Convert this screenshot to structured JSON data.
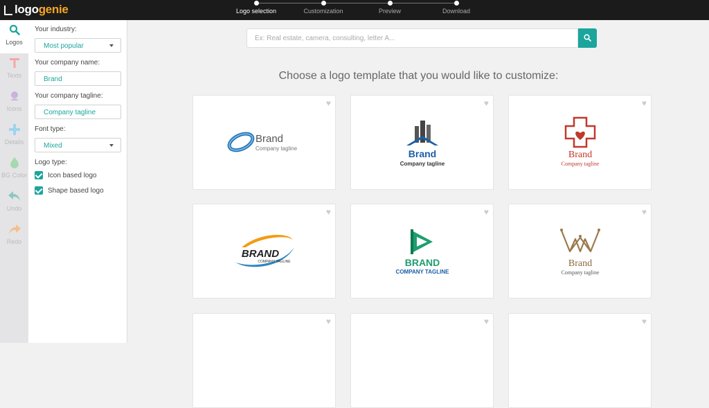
{
  "brand": {
    "part1": "logo",
    "part2": "genie"
  },
  "steps": [
    {
      "label": "Logo selection",
      "active": true
    },
    {
      "label": "Customization",
      "active": false
    },
    {
      "label": "Preview",
      "active": false
    },
    {
      "label": "Download",
      "active": false
    }
  ],
  "toolbar": [
    {
      "label": "Logos",
      "icon": "search-icon",
      "color": "#1ba59c"
    },
    {
      "label": "Texts",
      "icon": "text-icon",
      "color": "#f4a7a7"
    },
    {
      "label": "Icons",
      "icon": "icons-icon",
      "color": "#c9b3dd"
    },
    {
      "label": "Details",
      "icon": "plus-icon",
      "color": "#9fd3ef"
    },
    {
      "label": "BG Color",
      "icon": "drop-icon",
      "color": "#a7d9b0"
    },
    {
      "label": "Undo",
      "icon": "undo-icon",
      "color": "#8ec7c2"
    },
    {
      "label": "Redo",
      "icon": "redo-icon",
      "color": "#f5c08a"
    }
  ],
  "panel": {
    "industry_label": "Your industry:",
    "industry_value": "Most popular",
    "company_label": "Your company name:",
    "company_value": "Brand",
    "tagline_label": "Your company tagline:",
    "tagline_value": "Company tagline",
    "font_label": "Font type:",
    "font_value": "Mixed",
    "logotype_label": "Logo type:",
    "opt_icon": "Icon based logo",
    "opt_shape": "Shape based logo"
  },
  "search": {
    "placeholder": "Ex: Real estate, camera, consulting, letter A..."
  },
  "headline": "Choose a logo template that you would like to customize:",
  "cards": [
    {
      "name": "Brand",
      "tagline": "Company tagline"
    },
    {
      "name": "Brand",
      "tagline": "Company tagline"
    },
    {
      "name": "Brand",
      "tagline": "Company tagline"
    },
    {
      "name": "BRAND",
      "tagline": "COMPANY TAGLINE"
    },
    {
      "name": "BRAND",
      "tagline": "COMPANY TAGLINE"
    },
    {
      "name": "Brand",
      "tagline": "Company tagline"
    }
  ],
  "colors": {
    "accent": "#1ba59c",
    "topbar": "#1b1b1b",
    "brand_orange": "#f5a623"
  }
}
